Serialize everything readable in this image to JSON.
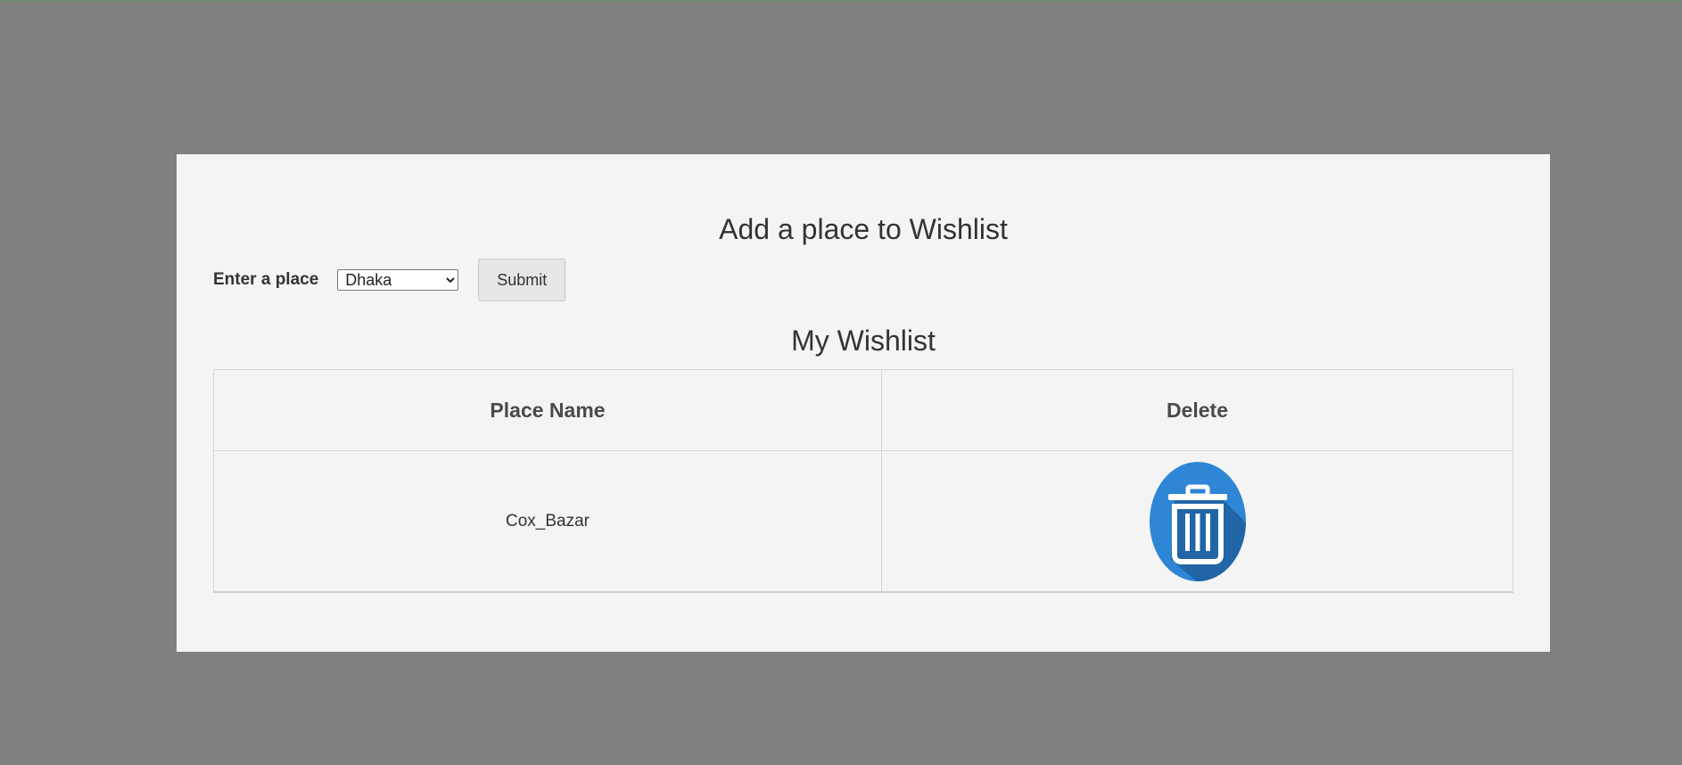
{
  "form": {
    "title": "Add a place to Wishlist",
    "label": "Enter a place",
    "selected_place": "Dhaka",
    "submit_label": "Submit"
  },
  "wishlist": {
    "title": "My Wishlist",
    "columns": [
      "Place Name",
      "Delete"
    ],
    "rows": [
      {
        "place_name": "Cox_Bazar",
        "delete_icon": "trash-icon"
      }
    ]
  },
  "colors": {
    "background": "#808080",
    "card": "#f4f4f4",
    "trash_circle": "#2f86d6",
    "trash_shadow": "#1f5f9e"
  }
}
